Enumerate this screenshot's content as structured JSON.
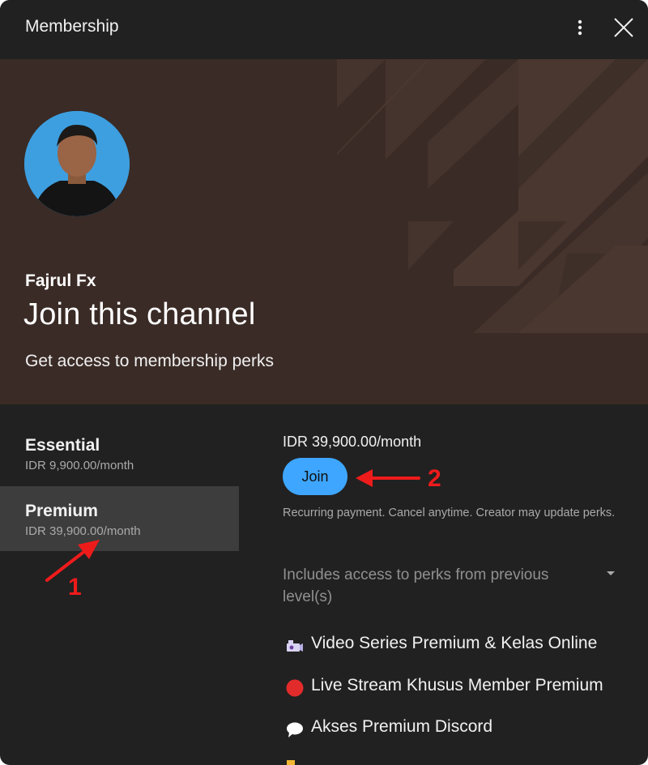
{
  "dialog": {
    "title": "Membership",
    "more_icon": "more-vert-icon",
    "close_icon": "close-icon"
  },
  "banner": {
    "channel_name": "Fajrul Fx",
    "heading": "Join this channel",
    "subtitle": "Get access to membership perks",
    "background_color": "#3a2b26"
  },
  "tiers": [
    {
      "name": "Essential",
      "price": "IDR 9,900.00/month",
      "selected": false
    },
    {
      "name": "Premium",
      "price": "IDR 39,900.00/month",
      "selected": true
    }
  ],
  "detail": {
    "price": "IDR 39,900.00/month",
    "join_label": "Join",
    "recurring_note": "Recurring payment. Cancel anytime. Creator may update perks.",
    "includes_label": "Includes access to perks from previous level(s)",
    "perks": [
      {
        "icon": "video-camera-icon",
        "label": "Video Series Premium & Kelas Online"
      },
      {
        "icon": "red-circle-icon",
        "label": "Live Stream Khusus Member Premium"
      },
      {
        "icon": "speech-bubble-icon",
        "label": "Akses Premium Discord"
      }
    ]
  },
  "annotations": {
    "marker_1": "1",
    "marker_2": "2",
    "color": "#ee1b1b"
  },
  "colors": {
    "accent": "#3ea6ff",
    "panel": "#212121",
    "selected_tier": "#3d3d3d"
  }
}
